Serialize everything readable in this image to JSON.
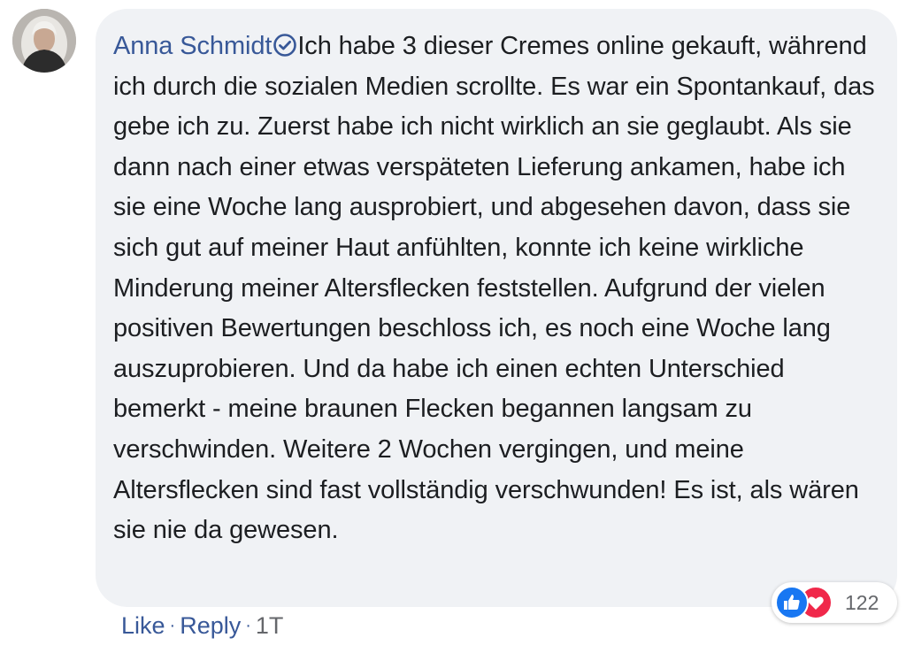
{
  "comment": {
    "author": "Anna Schmidt",
    "verified_icon": "verified-check-icon",
    "text": "Ich habe 3 dieser Cremes online gekauft, während ich durch die sozialen Medien scrollte. Es war ein Spontankauf, das gebe ich zu. Zuerst habe ich nicht wirklich an sie geglaubt. Als sie dann nach einer etwas verspäteten Lieferung ankamen, habe ich sie eine Woche lang ausprobiert, und abgesehen davon, dass sie sich gut auf meiner Haut anfühlten, konnte ich keine wirkliche Minderung meiner Altersflecken feststellen. Aufgrund der vielen positiven Bewertungen beschloss ich, es noch eine Woche lang auszuprobieren. Und da habe ich einen echten Unterschied bemerkt - meine braunen Flecken begannen langsam zu verschwinden. Weitere 2 Wochen vergingen, und meine Altersflecken sind fast vollständig verschwunden! Es ist, als wären sie nie da gewesen."
  },
  "reactions": {
    "icons": [
      "like-icon",
      "love-icon"
    ],
    "count": "122"
  },
  "actions": {
    "like_label": "Like",
    "separator": "·",
    "reply_label": "Reply",
    "timestamp": "1T"
  },
  "colors": {
    "bubble": "#f0f2f5",
    "author": "#385898",
    "text": "#1c1e21",
    "like": "#1877f2",
    "love": "#f0284a",
    "meta": "#65676b"
  }
}
